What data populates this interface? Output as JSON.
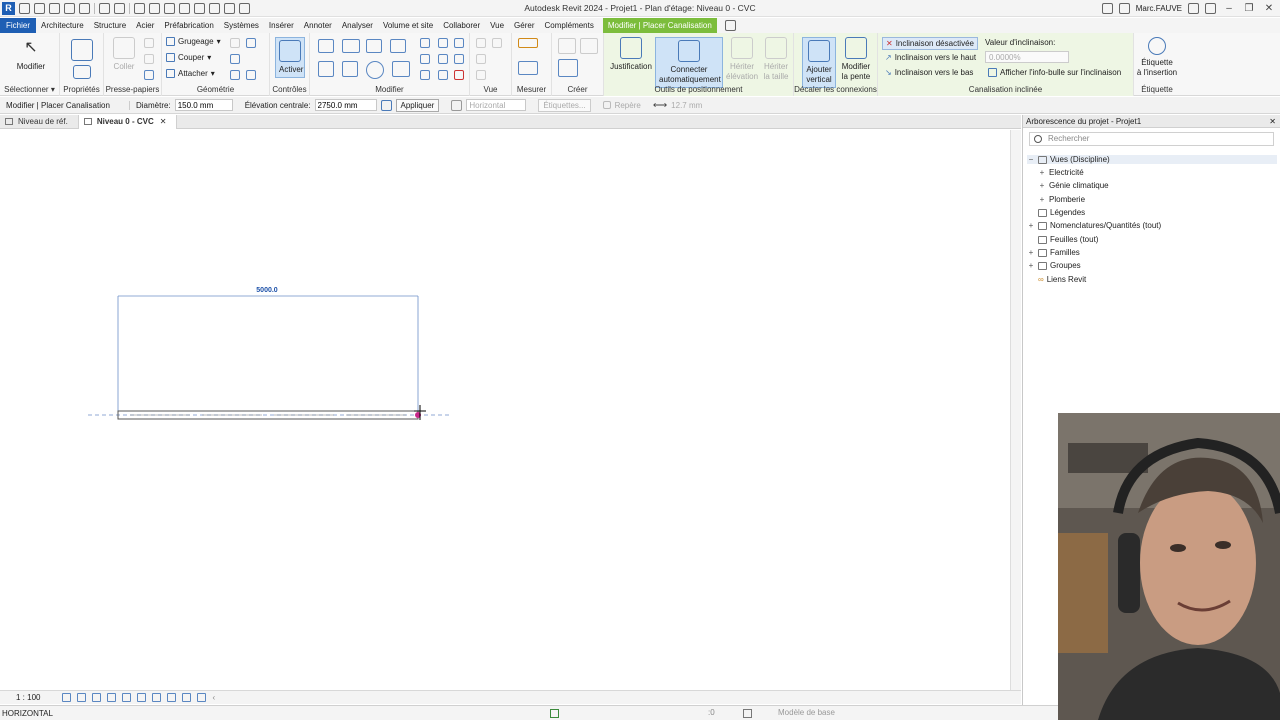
{
  "app": {
    "title": "Autodesk Revit 2024 - Projet1 - Plan d'étage: Niveau 0 - CVC",
    "logo": "R",
    "user": "Marc.FAUVE"
  },
  "tabs": [
    "Fichier",
    "Architecture",
    "Structure",
    "Acier",
    "Préfabrication",
    "Systèmes",
    "Insérer",
    "Annoter",
    "Analyser",
    "Volume et site",
    "Collaborer",
    "Vue",
    "Gérer",
    "Compléments"
  ],
  "context_tab": "Modifier | Placer Canalisation",
  "ribbon": {
    "selectionner": {
      "label": "Sélectionner",
      "btn": "Modifier"
    },
    "proprietes": {
      "label": "Propriétés"
    },
    "presse_papiers": {
      "label": "Presse-papiers",
      "coller": "Coller"
    },
    "geometrie": {
      "label": "Géométrie",
      "items": [
        "Grugeage",
        "Couper",
        "Attacher"
      ]
    },
    "controles": {
      "label": "Contrôles",
      "btn": "Activer"
    },
    "modifier": {
      "label": "Modifier"
    },
    "vue": {
      "label": "Vue"
    },
    "mesurer": {
      "label": "Mesurer"
    },
    "creer": {
      "label": "Créer"
    },
    "outils_positionnement": {
      "label": "Outils de positionnement",
      "justification": "Justification",
      "connecter_1": "Connecter",
      "connecter_2": "automatiquement",
      "heriter_elev_1": "Hériter",
      "heriter_elev_2": "élévation",
      "heriter_taille_1": "Hériter",
      "heriter_taille_2": "la taille"
    },
    "decaler": {
      "label": "Décaler les connexions",
      "ajouter_1": "Ajouter",
      "ajouter_2": "vertical",
      "modifier_1": "Modifier",
      "modifier_2": "la pente"
    },
    "canalisation_inclinee": {
      "label": "Canalisation inclinée",
      "desactivee": "Inclinaison désactivée",
      "haut": "Inclinaison vers le haut",
      "bas": "Inclinaison vers le bas",
      "valeur_label": "Valeur d'inclinaison:",
      "valeur": "0.0000%",
      "infobulle": "Afficher l'info-bulle sur l'inclinaison"
    },
    "etiquette": {
      "label": "Étiquette",
      "btn_1": "Étiquette",
      "btn_2": "à l'insertion"
    }
  },
  "options_bar": {
    "context": "Modifier | Placer Canalisation",
    "diametre_label": "Diamètre:",
    "diametre": "150.0 mm",
    "elevation_label": "Élévation centrale:",
    "elevation": "2750.0 mm",
    "appliquer": "Appliquer",
    "horizontal": "Horizontal",
    "etiquettes": "Étiquettes...",
    "repere": "Repère",
    "longueur": "12.7 mm"
  },
  "view_tabs": [
    {
      "label": "Niveau de réf.",
      "active": false
    },
    {
      "label": "Niveau 0 - CVC",
      "active": true
    }
  ],
  "canvas": {
    "dimension": "5000.0"
  },
  "view_control": {
    "scale": "1 : 100"
  },
  "status_bar": {
    "left": "HORIZONTAL",
    "model": "Modèle de base",
    "sel_count": ":0"
  },
  "browser": {
    "title": "Arborescence du projet - Projet1",
    "search_placeholder": "Rechercher",
    "nodes": [
      {
        "label": "Vues (Discipline)",
        "exp": "−"
      },
      {
        "label": "Electricité",
        "exp": "+"
      },
      {
        "label": "Génie climatique",
        "exp": "+"
      },
      {
        "label": "Plomberie",
        "exp": "+"
      },
      {
        "label": "Légendes",
        "exp": ""
      },
      {
        "label": "Nomenclatures/Quantités (tout)",
        "exp": "+"
      },
      {
        "label": "Feuilles (tout)",
        "exp": ""
      },
      {
        "label": "Familles",
        "exp": "+"
      },
      {
        "label": "Groupes",
        "exp": "+"
      },
      {
        "label": "Liens Revit",
        "exp": ""
      }
    ]
  },
  "colors": {
    "accent": "#1f5fb4",
    "context": "#7cbd3c",
    "dimension": "#1a4fa8",
    "pipe_end": "#c8288a"
  }
}
